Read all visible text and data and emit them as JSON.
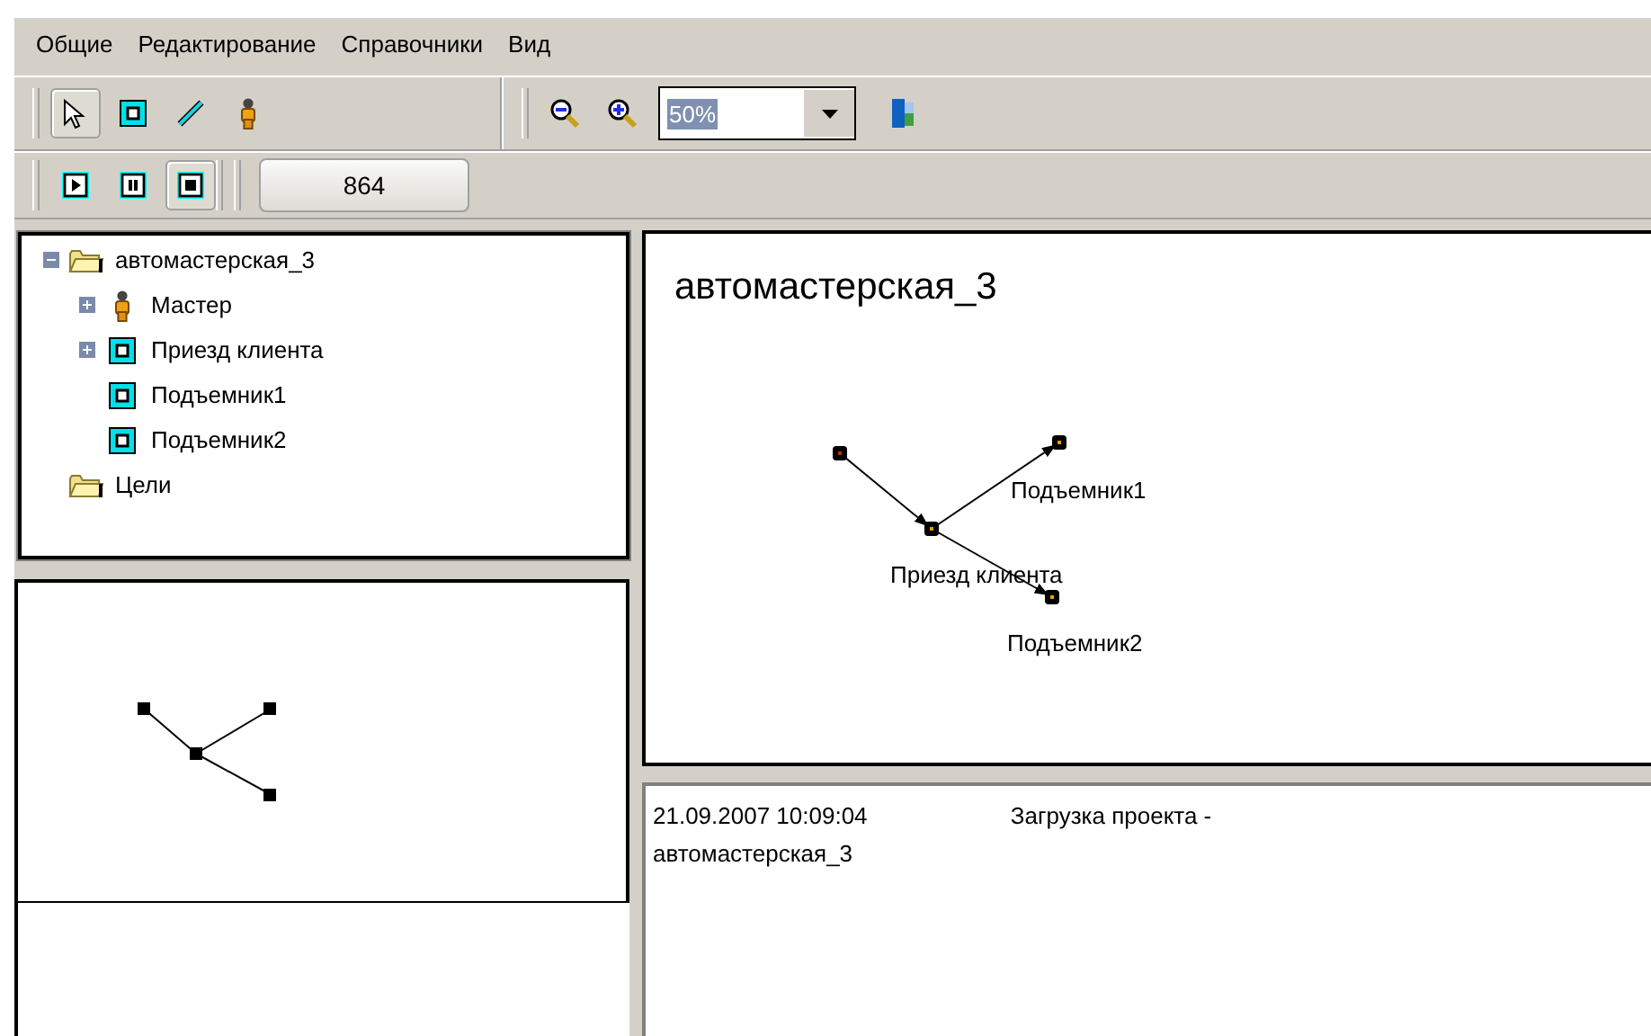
{
  "menu": [
    "Общие",
    "Редактирование",
    "Справочники",
    "Вид"
  ],
  "tools": [
    {
      "kind": "pointer",
      "selected": true
    },
    {
      "kind": "process",
      "selected": false
    },
    {
      "kind": "link",
      "selected": false
    },
    {
      "kind": "agent",
      "selected": false
    }
  ],
  "zoom": {
    "value": "50%"
  },
  "playback": [
    {
      "kind": "play",
      "selected": false
    },
    {
      "kind": "pause",
      "selected": false
    },
    {
      "kind": "stop",
      "selected": true
    }
  ],
  "counter": "864",
  "tree": [
    {
      "label": "автомастерская_3",
      "kind": "folder",
      "expanded": true,
      "children": [
        {
          "label": "Мастер",
          "kind": "agent",
          "expanded": false
        },
        {
          "label": "Приезд клиента",
          "kind": "process",
          "expanded": false
        },
        {
          "label": "Подъемник1",
          "kind": "process"
        },
        {
          "label": "Подъемник2",
          "kind": "process"
        }
      ]
    },
    {
      "label": "Цели",
      "kind": "folder"
    }
  ],
  "diagram": {
    "title": "автомастерская_3",
    "nodes": [
      {
        "kind": "start"
      },
      {
        "kind": "process",
        "label": "Приезд клиента"
      },
      {
        "kind": "process",
        "label": "Подъемник1"
      },
      {
        "kind": "process",
        "label": "Подъемник2"
      }
    ]
  },
  "log": [
    {
      "time": "21.09.2007 10:09:04",
      "message": "Загрузка проекта - автомастерская_3"
    }
  ]
}
